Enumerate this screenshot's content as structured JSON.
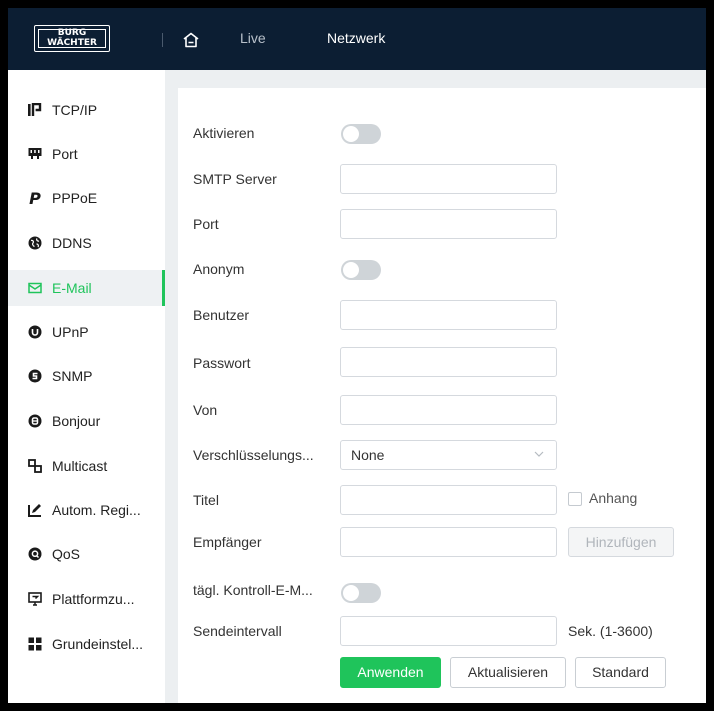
{
  "header": {
    "logo_line1": "BURG",
    "logo_line2": "WÄCHTER",
    "nav_live": "Live",
    "nav_netzwerk": "Netzwerk",
    "home_icon": "home-icon"
  },
  "colors": {
    "topbar": "#0c1e33",
    "accent": "#1fc45b",
    "background": "#eceff1"
  },
  "sidebar": {
    "items": [
      {
        "label": "TCP/IP",
        "icon": "ip-icon"
      },
      {
        "label": "Port",
        "icon": "port-icon"
      },
      {
        "label": "PPPoE",
        "icon": "pppoe-icon"
      },
      {
        "label": "DDNS",
        "icon": "globe-icon"
      },
      {
        "label": "E-Mail",
        "icon": "mail-icon",
        "active": true
      },
      {
        "label": "UPnP",
        "icon": "upnp-icon"
      },
      {
        "label": "SNMP",
        "icon": "snmp-icon"
      },
      {
        "label": "Bonjour",
        "icon": "bonjour-icon"
      },
      {
        "label": "Multicast",
        "icon": "multicast-icon"
      },
      {
        "label": "Autom. Regi...",
        "icon": "register-icon"
      },
      {
        "label": "QoS",
        "icon": "qos-icon"
      },
      {
        "label": "Plattformzu...",
        "icon": "platform-icon"
      },
      {
        "label": "Grundeinstel...",
        "icon": "grid-icon"
      }
    ]
  },
  "form": {
    "aktivieren_label": "Aktivieren",
    "aktivieren_on": false,
    "smtp_label": "SMTP Server",
    "smtp_value": "",
    "port_label": "Port",
    "port_value": "",
    "anonym_label": "Anonym",
    "anonym_on": false,
    "benutzer_label": "Benutzer",
    "benutzer_value": "",
    "passwort_label": "Passwort",
    "passwort_value": "",
    "von_label": "Von",
    "von_value": "",
    "verschl_label": "Verschlüsselungs...",
    "verschl_value": "None",
    "titel_label": "Titel",
    "titel_value": "",
    "anhang_label": "Anhang",
    "anhang_checked": false,
    "empfaenger_label": "Empfänger",
    "empfaenger_value": "",
    "hinzufuegen_label": "Hinzufügen",
    "kontroll_label": "tägl. Kontroll-E-M...",
    "kontroll_on": false,
    "sendeintervall_label": "Sendeintervall",
    "sendeintervall_value": "",
    "sendeintervall_unit": "Sek. (1-3600)"
  },
  "actions": {
    "apply": "Anwenden",
    "refresh": "Aktualisieren",
    "default": "Standard"
  }
}
